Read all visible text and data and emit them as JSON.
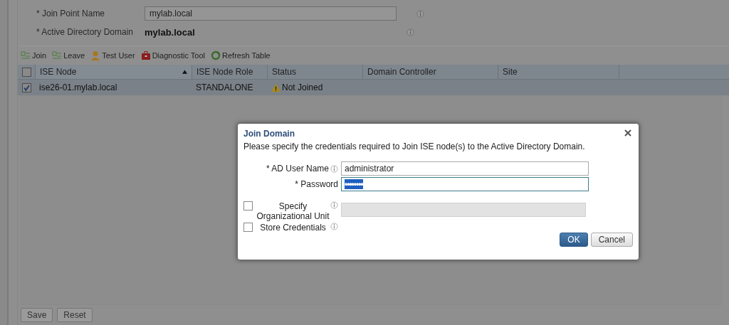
{
  "form": {
    "fields": [
      {
        "label": "* Join Point Name",
        "kind": "input",
        "value": "mylab.local"
      },
      {
        "label": "* Active Directory Domain",
        "kind": "text",
        "value": "mylab.local"
      }
    ]
  },
  "toolbar": [
    "Join",
    "Leave",
    "Test User",
    "Diagnostic Tool",
    "Refresh Table"
  ],
  "table": {
    "header_checked": false,
    "columns": [
      {
        "label": "ISE Node",
        "sorted": true
      },
      {
        "label": "ISE Node Role",
        "sorted": false
      },
      {
        "label": "Status",
        "sorted": false
      },
      {
        "label": "Domain Controller",
        "sorted": false
      },
      {
        "label": "Site",
        "sorted": false
      }
    ],
    "rows": [
      {
        "checked": true,
        "cells": [
          "ise26-01.mylab.local",
          "STANDALONE",
          "Not Joined",
          "",
          ""
        ],
        "status_warning": true
      }
    ]
  },
  "footer_buttons": [
    "Save",
    "Reset"
  ],
  "dialog": {
    "title": "Join Domain",
    "message": "Please specify the credentials required to Join ISE node(s) to the Active Directory Domain.",
    "fields": [
      {
        "label": "* AD User Name",
        "info": true,
        "value": "administrator",
        "kind": "text",
        "focused": false
      },
      {
        "label": "* Password",
        "info": false,
        "value": "••••••••",
        "kind": "password",
        "focused": true
      }
    ],
    "options": [
      {
        "label": "Specify Organizational Unit",
        "checked": false,
        "has_input": true
      },
      {
        "label": "Store Credentials",
        "checked": false,
        "has_input": false
      }
    ],
    "buttons": [
      {
        "label": "OK",
        "primary": true
      },
      {
        "label": "Cancel",
        "primary": false
      }
    ]
  }
}
